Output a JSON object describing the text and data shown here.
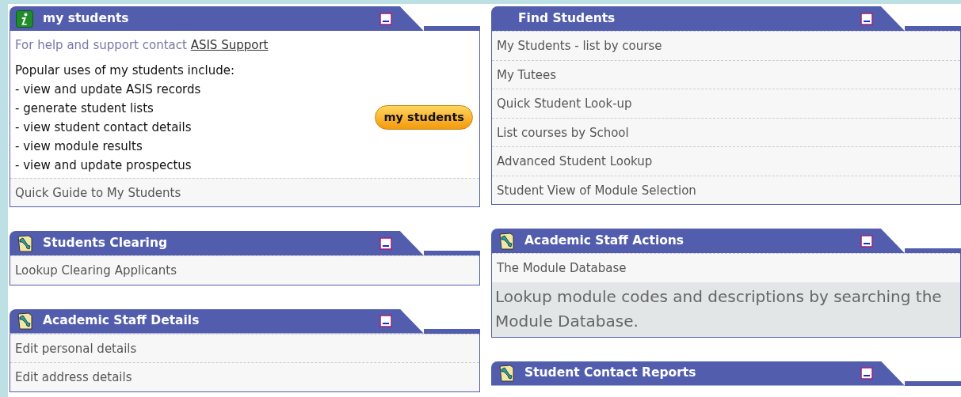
{
  "columns": [
    [
      {
        "title": "my students",
        "kind": "info",
        "items": [
          {
            "kind": "help",
            "text": "For help and support contact ",
            "link": "ASIS Support"
          },
          {
            "kind": "uses",
            "heading": "Popular uses of my students include:",
            "lines": [
              "- view and update ASIS records",
              "- generate student lists",
              "- view student contact details",
              "- view module results",
              "- view and update prospectus"
            ],
            "button": "my students"
          },
          {
            "kind": "link",
            "text": "Quick Guide to My Students"
          }
        ]
      },
      {
        "title": "Students Clearing",
        "kind": "tools",
        "items": [
          {
            "kind": "link",
            "text": "Lookup Clearing Applicants"
          }
        ]
      },
      {
        "title": "Academic Staff Details",
        "kind": "tools",
        "items": [
          {
            "kind": "link",
            "text": "Edit personal details"
          },
          {
            "kind": "link",
            "text": "Edit address details"
          }
        ]
      }
    ],
    [
      {
        "title": "Find Students",
        "kind": "plain",
        "items": [
          {
            "kind": "link",
            "text": "My Students - list by course"
          },
          {
            "kind": "link",
            "text": "My Tutees"
          },
          {
            "kind": "link",
            "text": "Quick Student Look-up"
          },
          {
            "kind": "link",
            "text": "List courses by School"
          },
          {
            "kind": "link",
            "text": "Advanced Student Lookup"
          },
          {
            "kind": "link",
            "text": "Student View of Module Selection"
          }
        ]
      },
      {
        "title": "Academic Staff Actions",
        "kind": "tools",
        "items": [
          {
            "kind": "link",
            "text": "The Module Database"
          },
          {
            "kind": "description",
            "text": "Lookup module codes and descriptions by searching the Module Database."
          }
        ]
      },
      {
        "title": "Student Contact Reports",
        "kind": "tools"
      }
    ]
  ]
}
